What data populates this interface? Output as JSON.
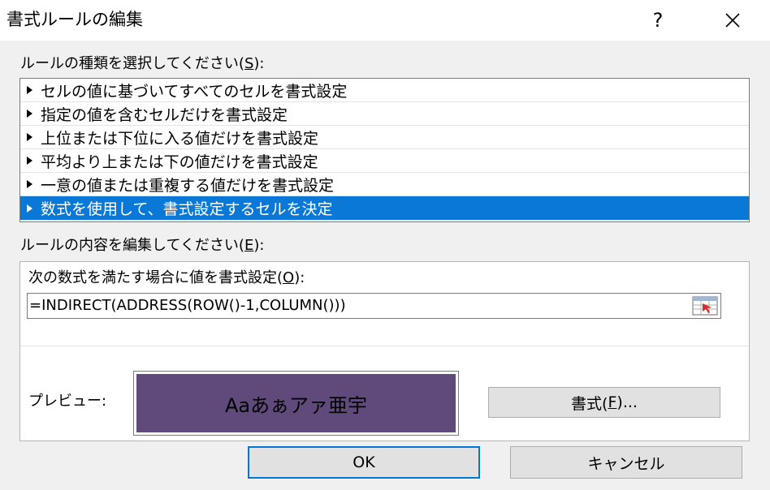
{
  "window": {
    "title": "書式ルールの編集",
    "help_label": "?"
  },
  "rule_type": {
    "label_prefix": "ルールの種類を選択してください(",
    "label_key": "S",
    "label_suffix": "):",
    "items": [
      {
        "label": "セルの値に基づいてすべてのセルを書式設定",
        "selected": false
      },
      {
        "label": "指定の値を含むセルだけを書式設定",
        "selected": false
      },
      {
        "label": "上位または下位に入る値だけを書式設定",
        "selected": false
      },
      {
        "label": "平均より上または下の値だけを書式設定",
        "selected": false
      },
      {
        "label": "一意の値または重複する値だけを書式設定",
        "selected": false
      },
      {
        "label": "数式を使用して、書式設定するセルを決定",
        "selected": true
      }
    ]
  },
  "rule_edit": {
    "label_prefix": "ルールの内容を編集してください(",
    "label_key": "E",
    "label_suffix": "):",
    "formula_label_prefix": "次の数式を満たす場合に値を書式設定(",
    "formula_label_key": "O",
    "formula_label_suffix": "):",
    "formula_value": "=INDIRECT(ADDRESS(ROW()-1,COLUMN()))",
    "preview_label": "プレビュー:",
    "preview_text": "Aaあぁアァ亜宇",
    "preview_fill_color": "#604a7b",
    "format_button_prefix": "書式(",
    "format_button_key": "F",
    "format_button_suffix": ")..."
  },
  "buttons": {
    "ok": "OK",
    "cancel": "キャンセル"
  },
  "colors": {
    "selection": "#0a78d7",
    "default_button_border": "#0078d7"
  }
}
